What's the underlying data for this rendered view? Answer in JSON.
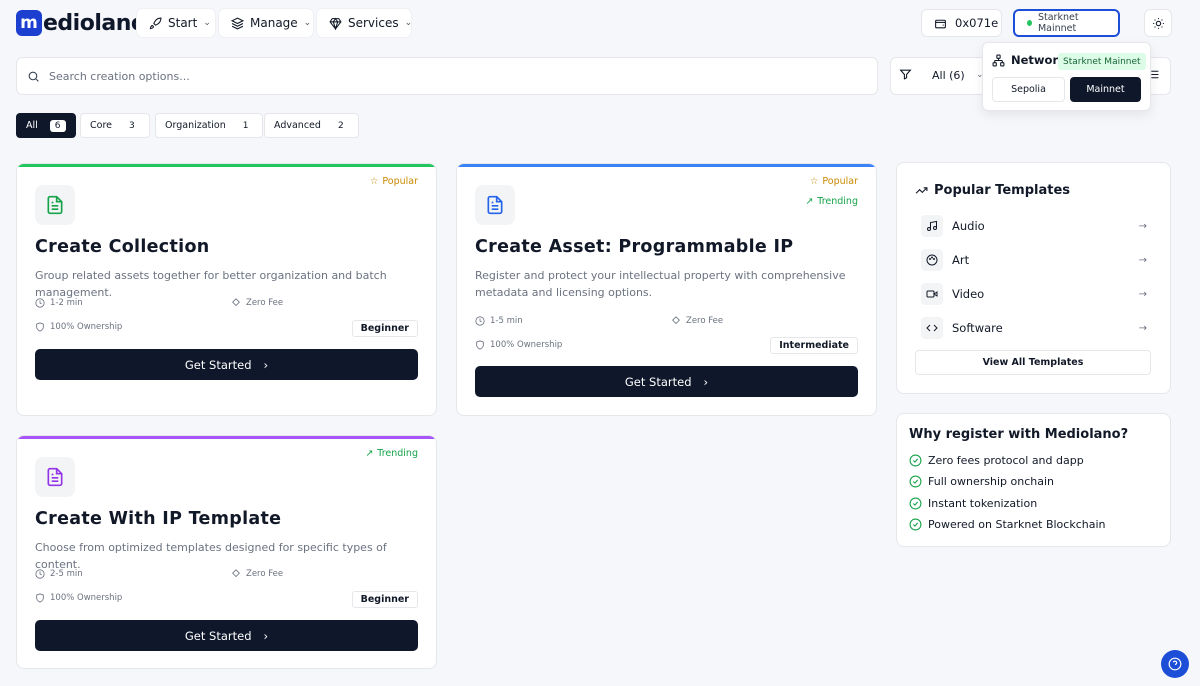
{
  "brand": {
    "mark": "m",
    "name": "ediolano"
  },
  "nav": {
    "start": "Start",
    "manage": "Manage",
    "services": "Services"
  },
  "wallet": {
    "address": "0x071e"
  },
  "network": {
    "button_label": "Starknet Mainnet",
    "popover_title": "Network",
    "current": "Starknet Mainnet",
    "options": [
      "Sepolia",
      "Mainnet"
    ],
    "selected": "Mainnet"
  },
  "search": {
    "placeholder": "Search creation options..."
  },
  "filter": {
    "value": "All (6)"
  },
  "tabs": [
    {
      "label": "All",
      "count": "6",
      "active": true
    },
    {
      "label": "Core",
      "count": "3"
    },
    {
      "label": "Organization",
      "count": "1"
    },
    {
      "label": "Advanced",
      "count": "2"
    }
  ],
  "cards": [
    {
      "title": "Create Collection",
      "description": "Group related assets together for better organization and batch management.",
      "badges": [
        "Popular"
      ],
      "time": "1-2 min",
      "fee": "Zero Fee",
      "ownership": "100% Ownership",
      "level": "Beginner",
      "cta": "Get Started",
      "accent": "#22c55e"
    },
    {
      "title": "Create Asset: Programmable IP",
      "description": "Register and protect your intellectual property with comprehensive metadata and licensing options.",
      "badges": [
        "Popular",
        "Trending"
      ],
      "time": "1-5 min",
      "fee": "Zero Fee",
      "ownership": "100% Ownership",
      "level": "Intermediate",
      "cta": "Get Started",
      "accent": "#3b82f6"
    },
    {
      "title": "Create With IP Template",
      "description": "Choose from optimized templates designed for specific types of content.",
      "badges": [
        "Trending"
      ],
      "time": "2-5 min",
      "fee": "Zero Fee",
      "ownership": "100% Ownership",
      "level": "Beginner",
      "cta": "Get Started",
      "accent": "#a855f7"
    }
  ],
  "popular_templates": {
    "title": "Popular Templates",
    "items": [
      {
        "label": "Audio",
        "icon": "music-icon"
      },
      {
        "label": "Art",
        "icon": "palette-icon"
      },
      {
        "label": "Video",
        "icon": "video-icon"
      },
      {
        "label": "Software",
        "icon": "code-icon"
      }
    ],
    "view_all": "View All Templates"
  },
  "why": {
    "title": "Why register with Mediolano?",
    "items": [
      "Zero fees protocol and dapp",
      "Full ownership onchain",
      "Instant tokenization",
      "Powered on Starknet Blockchain"
    ]
  },
  "colors": {
    "dark": "#0f172a",
    "brand": "#1d3fd0",
    "popular": "#ca8a04",
    "trending": "#16a34a"
  }
}
